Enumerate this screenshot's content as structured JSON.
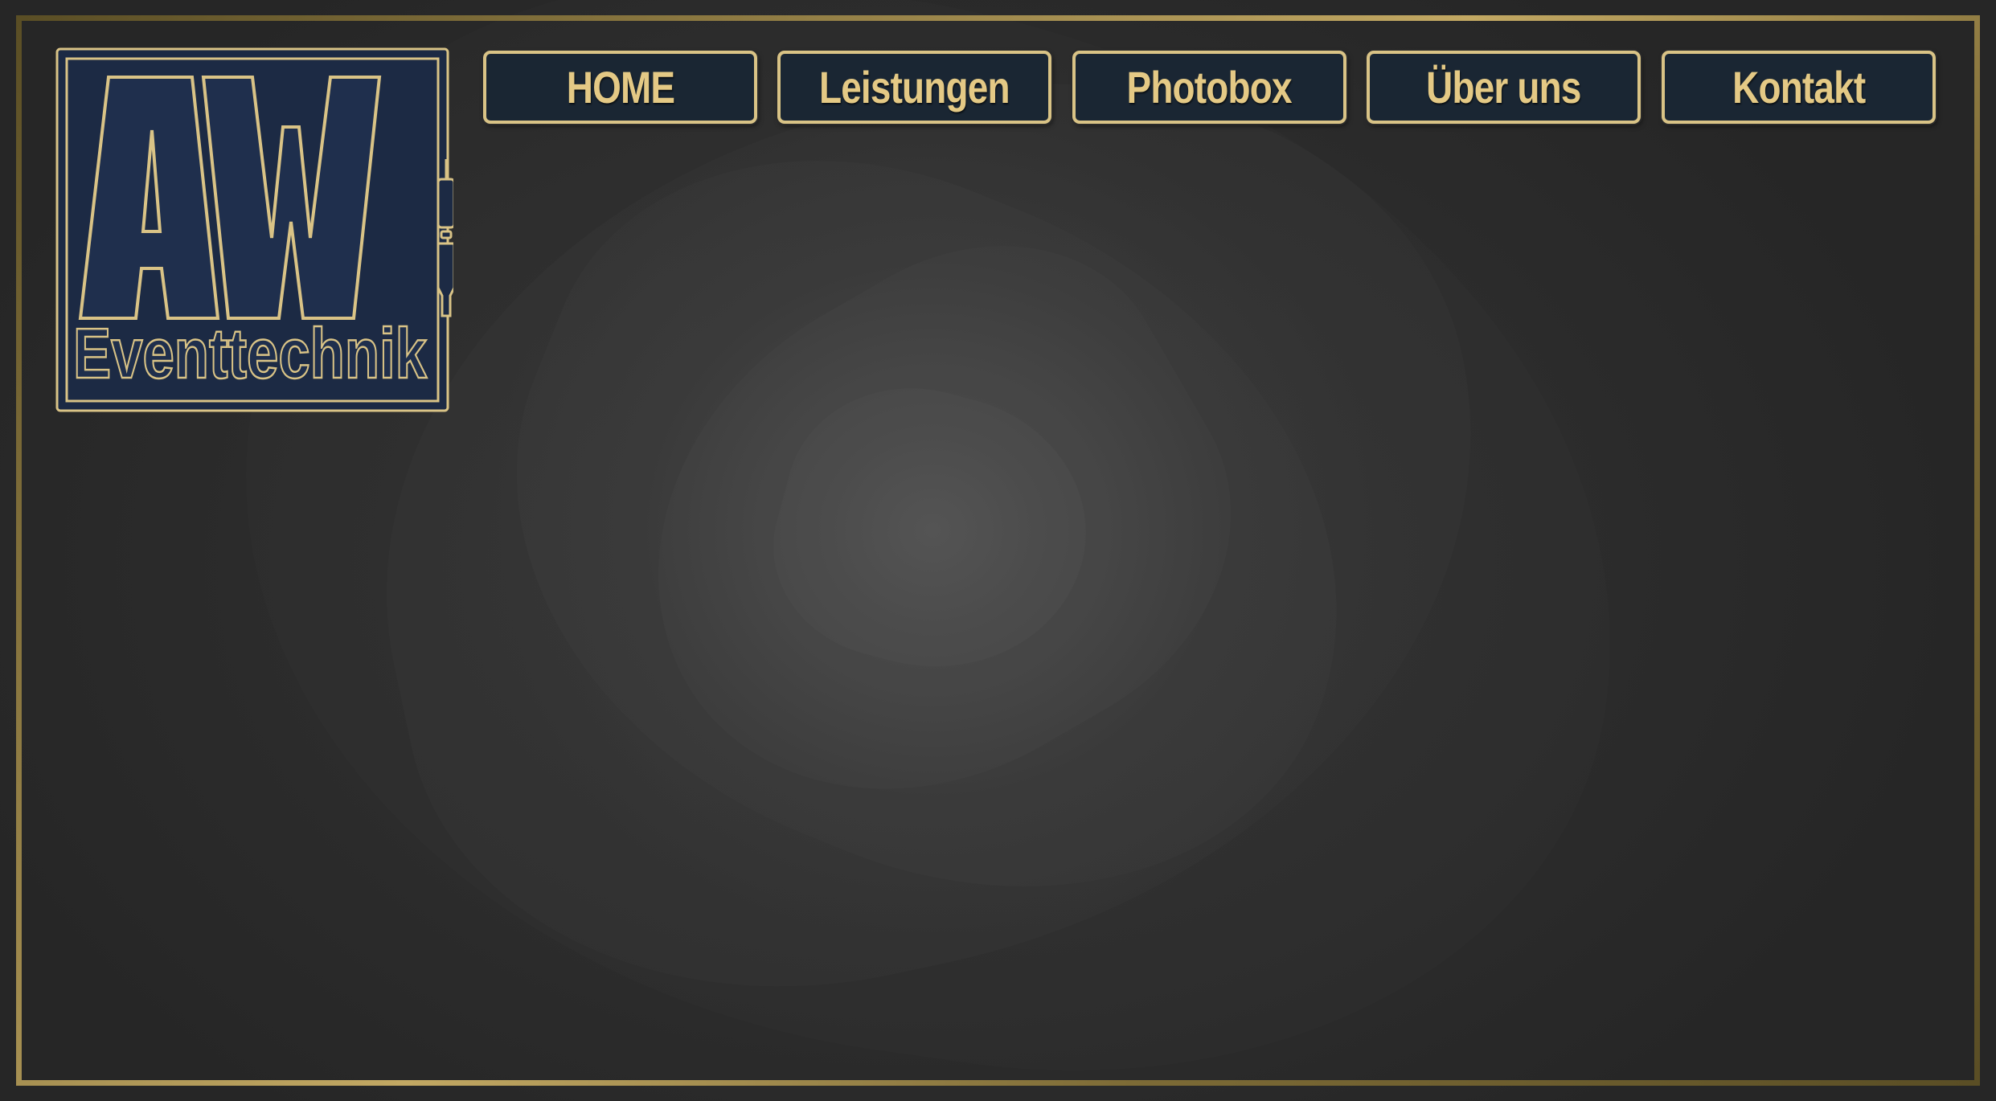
{
  "logo": {
    "letters": "AW",
    "subtitle": "Eventtechnik"
  },
  "nav": {
    "items": [
      {
        "label": "HOME"
      },
      {
        "label": "Leistungen"
      },
      {
        "label": "Photobox"
      },
      {
        "label": "Über uns"
      },
      {
        "label": "Kontakt"
      }
    ]
  },
  "colors": {
    "background": "#2b2b2b",
    "gold": "#e4c985",
    "button_fill": "#1a2633",
    "logo_fill": "#1f2f4d",
    "frame": "#8a7740"
  }
}
